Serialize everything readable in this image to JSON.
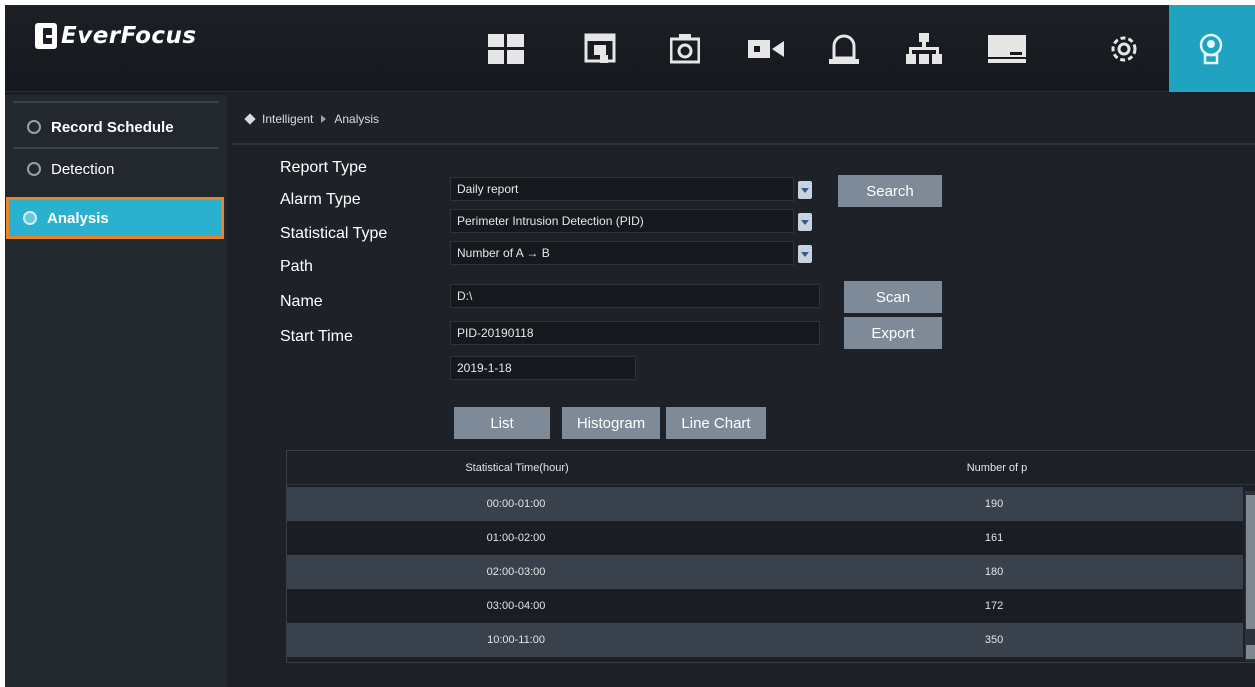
{
  "brand": {
    "name": "EverFocus"
  },
  "nav": {
    "icons": [
      "layout-icon",
      "playback-icon",
      "snapshot-icon",
      "camera-icon",
      "alarm-icon",
      "network-icon",
      "storage-icon",
      "settings-icon",
      "intelligent-icon"
    ],
    "active": "intelligent-icon"
  },
  "sidebar": {
    "items": [
      {
        "label": "Record Schedule",
        "selected": false
      },
      {
        "label": "Detection",
        "selected": false
      },
      {
        "label": "Analysis",
        "selected": true
      }
    ]
  },
  "breadcrumb": {
    "root": "Intelligent",
    "current": "Analysis"
  },
  "form": {
    "report_type_label": "Report Type",
    "report_type_value": "Daily report",
    "alarm_type_label": "Alarm Type",
    "alarm_type_value": "Perimeter Intrusion Detection (PID)",
    "statistical_type_label": "Statistical Type",
    "statistical_type_value": "Number of A → B",
    "path_label": "Path",
    "path_value": "D:\\",
    "name_label": "Name",
    "name_value": "PID-20190118",
    "start_time_label": "Start Time",
    "start_time_value": "2019-1-18"
  },
  "buttons": {
    "search": "Search",
    "scan": "Scan",
    "export": "Export",
    "list": "List",
    "histogram": "Histogram",
    "line_chart": "Line Chart"
  },
  "table": {
    "headers": [
      "Statistical Time(hour)",
      "Number of p"
    ],
    "rows": [
      [
        "00:00-01:00",
        "190"
      ],
      [
        "01:00-02:00",
        "161"
      ],
      [
        "02:00-03:00",
        "180"
      ],
      [
        "03:00-04:00",
        "172"
      ],
      [
        "10:00-11:00",
        "350"
      ]
    ]
  },
  "colors": {
    "accent": "#1fa3c0",
    "selection_outline": "#e8852a",
    "button": "#7e8a98"
  }
}
